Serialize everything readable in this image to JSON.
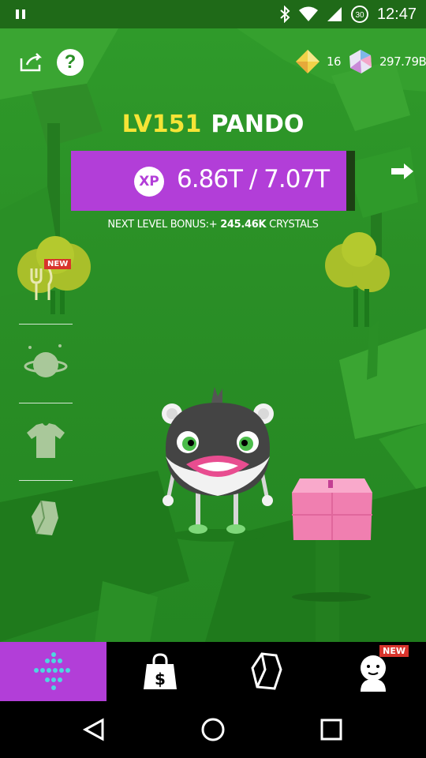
{
  "status_bar": {
    "time": "12:47",
    "battery_level": "30",
    "icons": [
      "pause-icon",
      "bluetooth-icon",
      "wifi-icon",
      "signal-icon",
      "battery-icon"
    ]
  },
  "header": {
    "share_icon": "share-icon",
    "help_label": "?",
    "currencies": [
      {
        "icon": "diamond-icon",
        "value": "16"
      },
      {
        "icon": "gem-icon",
        "value": "297.79B"
      }
    ]
  },
  "creature": {
    "level": "LV151",
    "name": "PANDO",
    "xp_badge": "XP",
    "xp_text": "6.86T / 7.07T",
    "xp_progress": 0.97,
    "next_bonus_label": "NEXT LEVEL BONUS:+",
    "next_bonus_value": "245.46K",
    "next_bonus_unit": "CRYSTALS"
  },
  "side_menu": [
    {
      "name": "food",
      "icon": "fork-icon",
      "badge": "NEW"
    },
    {
      "name": "planet",
      "icon": "planet-icon",
      "badge": ""
    },
    {
      "name": "outfit",
      "icon": "shirt-icon",
      "badge": ""
    },
    {
      "name": "crystal",
      "icon": "crystal-icon",
      "badge": ""
    }
  ],
  "tabs": [
    {
      "name": "home",
      "icon": "dots-icon",
      "active": true,
      "badge": ""
    },
    {
      "name": "shop",
      "icon": "shopping-bag-icon",
      "active": false,
      "badge": ""
    },
    {
      "name": "crystals",
      "icon": "crystal-icon",
      "active": false,
      "badge": ""
    },
    {
      "name": "characters",
      "icon": "character-icon",
      "active": false,
      "badge": "NEW"
    }
  ],
  "nav": [
    "back-icon",
    "home-icon",
    "recents-icon"
  ],
  "colors": {
    "accent_purple": "#b23ed8",
    "level_yellow": "#f5e436",
    "badge_red": "#d8342c",
    "game_green": "#2a8f26"
  }
}
